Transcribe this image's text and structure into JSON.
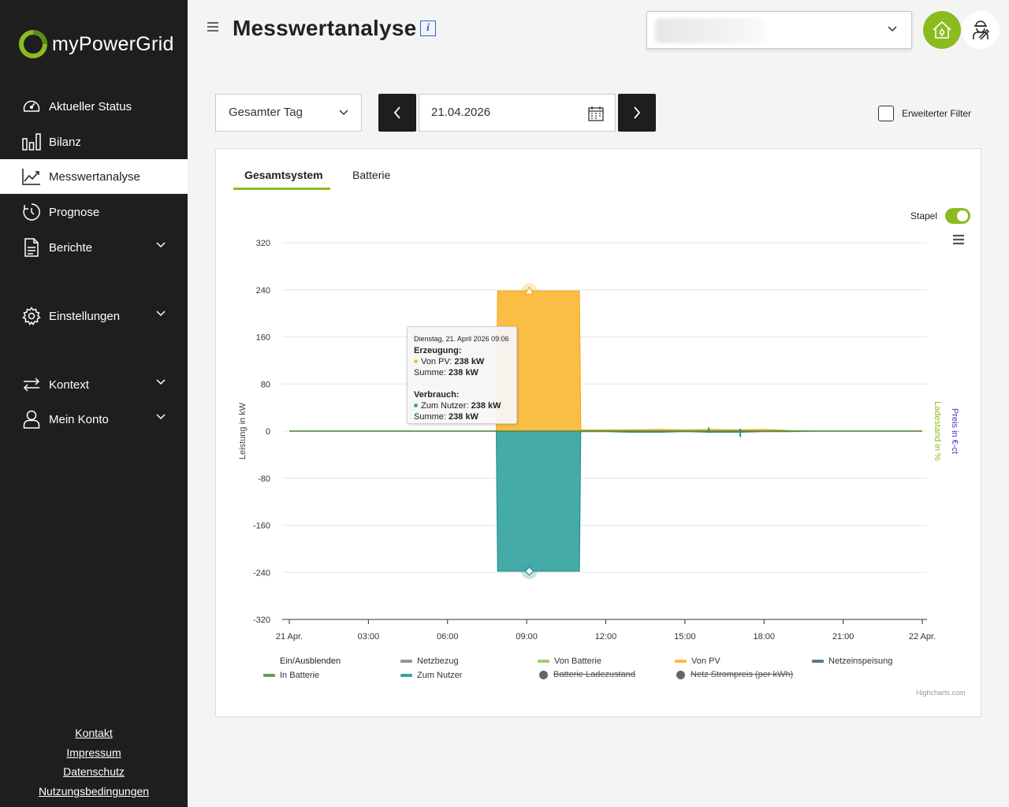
{
  "app": {
    "brand": "myPowerGrid",
    "colors": {
      "sidebar": "#1e1e1e",
      "accent": "#8bbb1f",
      "pv": "#fbbb3b",
      "user": "#3aa6a1",
      "grid_in": "#8c9aa3",
      "battery_out": "#9fd06e",
      "grid_feed": "#5a7b93",
      "battery_in": "#6d9a52",
      "soc": "#666666",
      "price": "#666666"
    }
  },
  "sidebar": {
    "items": [
      {
        "label": "Aktueller Status",
        "icon": "gauge-icon"
      },
      {
        "label": "Bilanz",
        "icon": "bar-chart-icon"
      },
      {
        "label": "Messwertanalyse",
        "icon": "line-chart-icon",
        "active": true
      },
      {
        "label": "Prognose",
        "icon": "clock-icon"
      },
      {
        "label": "Berichte",
        "icon": "document-icon",
        "expandable": true
      },
      {
        "label": "Einstellungen",
        "icon": "gear-icon",
        "expandable": true
      },
      {
        "label": "Kontext",
        "icon": "swap-arrows-icon",
        "expandable": true
      },
      {
        "label": "Mein Konto",
        "icon": "user-icon",
        "expandable": true
      }
    ],
    "footer": [
      "Kontakt",
      "Impressum",
      "Datenschutz",
      "Nutzungsbedingungen"
    ]
  },
  "header": {
    "title": "Messwertanalyse",
    "info_label": "i"
  },
  "filters": {
    "period": "Gesamter Tag",
    "date": "21.04.2026",
    "extended_filter_label": "Erweiterter Filter",
    "extended_filter_checked": false
  },
  "tabs": [
    {
      "label": "Gesamtsystem",
      "active": true
    },
    {
      "label": "Batterie",
      "active": false
    }
  ],
  "stack_toggle": {
    "label": "Stapel",
    "on": true
  },
  "tooltip": {
    "date": "Dienstag, 21. April 2026 09:06",
    "generation_header": "Erzeugung:",
    "generation_series": "Von PV:",
    "generation_value": "238 kW",
    "generation_sum_label": "Summe:",
    "generation_sum": "238 kW",
    "consumption_header": "Verbrauch:",
    "consumption_series": "Zum Nutzer:",
    "consumption_value": "238 kW",
    "consumption_sum_label": "Summe:",
    "consumption_sum": "238 kW"
  },
  "legend": {
    "toggle_label": "Ein/Ausblenden",
    "items": [
      {
        "label": "Netzbezug",
        "color": "#8c9aa3",
        "shape": "line",
        "hidden": false
      },
      {
        "label": "Von Batterie",
        "color": "#9fd06e",
        "shape": "line",
        "hidden": false
      },
      {
        "label": "Von PV",
        "color": "#fbbb3b",
        "shape": "line",
        "hidden": false
      },
      {
        "label": "Netzeinspeisung",
        "color": "#5a7b93",
        "shape": "line",
        "hidden": false
      },
      {
        "label": "In Batterie",
        "color": "#6d9a52",
        "shape": "line",
        "hidden": false
      },
      {
        "label": "Zum Nutzer",
        "color": "#3aa6a1",
        "shape": "line",
        "hidden": false
      },
      {
        "label": "Batterie Ladezustand",
        "color": "#666666",
        "shape": "dot",
        "hidden": true
      },
      {
        "label": "Netz Strompreis (per kWh)",
        "color": "#666666",
        "shape": "dot",
        "hidden": true
      }
    ]
  },
  "credits": "Highcharts.com",
  "chart_data": {
    "type": "area",
    "stacked": true,
    "title": "",
    "ylabel": "Leistung in kW",
    "ylabel_right_1": "Ladestand in %",
    "ylabel_right_2": "Preis in €-ct",
    "ylim": [
      -320,
      320
    ],
    "yticks": [
      320,
      240,
      160,
      80,
      0,
      -80,
      -160,
      -240,
      -320
    ],
    "xlim": [
      "21 Apr. 00:00",
      "22 Apr. 00:00"
    ],
    "xticks": [
      "21 Apr.",
      "03:00",
      "06:00",
      "09:00",
      "12:00",
      "15:00",
      "18:00",
      "21:00",
      "22 Apr."
    ],
    "x_hours": [
      0,
      3,
      6,
      9,
      12,
      15,
      18,
      21,
      24
    ],
    "grid": true,
    "series": [
      {
        "name": "Von PV",
        "side": "positive",
        "points": [
          [
            0,
            0
          ],
          [
            7.85,
            0
          ],
          [
            7.9,
            238
          ],
          [
            11,
            238
          ],
          [
            11.05,
            2
          ],
          [
            12,
            2
          ],
          [
            13,
            2
          ],
          [
            14,
            3
          ],
          [
            15,
            2
          ],
          [
            16,
            3
          ],
          [
            17,
            2
          ],
          [
            18,
            3
          ],
          [
            19,
            1
          ],
          [
            20,
            0
          ],
          [
            24,
            0
          ]
        ]
      },
      {
        "name": "Zum Nutzer",
        "side": "negative",
        "points": [
          [
            0,
            0
          ],
          [
            7.85,
            0
          ],
          [
            7.9,
            -238
          ],
          [
            11,
            -238
          ],
          [
            11.05,
            -1
          ],
          [
            12,
            -1
          ],
          [
            13,
            -2
          ],
          [
            14,
            -2
          ],
          [
            15,
            -1
          ],
          [
            16,
            -2
          ],
          [
            17,
            -2
          ],
          [
            18,
            -1
          ],
          [
            19,
            -1
          ],
          [
            20,
            0
          ],
          [
            24,
            0
          ]
        ]
      }
    ],
    "highlight_x_hour": 9.1
  }
}
